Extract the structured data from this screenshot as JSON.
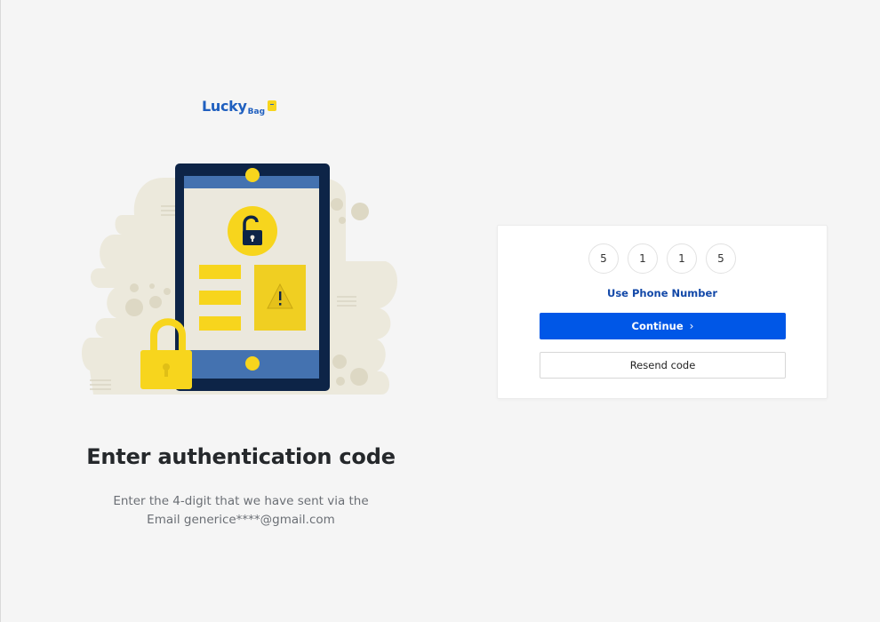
{
  "brand": {
    "name": "Lucky",
    "sub": "Bag"
  },
  "auth": {
    "heading": "Enter authentication code",
    "subtext_line1": "Enter the 4-digit that we have sent via the",
    "subtext_line2": "Email generice****@gmail.com"
  },
  "form": {
    "digits": [
      "5",
      "1",
      "1",
      "5"
    ],
    "use_phone_label": "Use Phone Number",
    "continue_label": "Continue",
    "resend_label": "Resend code"
  },
  "colors": {
    "primary": "#0057e7",
    "link": "#1248a8",
    "brand": "#1f5fbf",
    "accent_yellow": "#f7d51d",
    "phone_frame": "#0d2447"
  },
  "icons": [
    "lock-icon",
    "warning-icon",
    "chevron-right-icon",
    "shopping-bag-icon"
  ]
}
